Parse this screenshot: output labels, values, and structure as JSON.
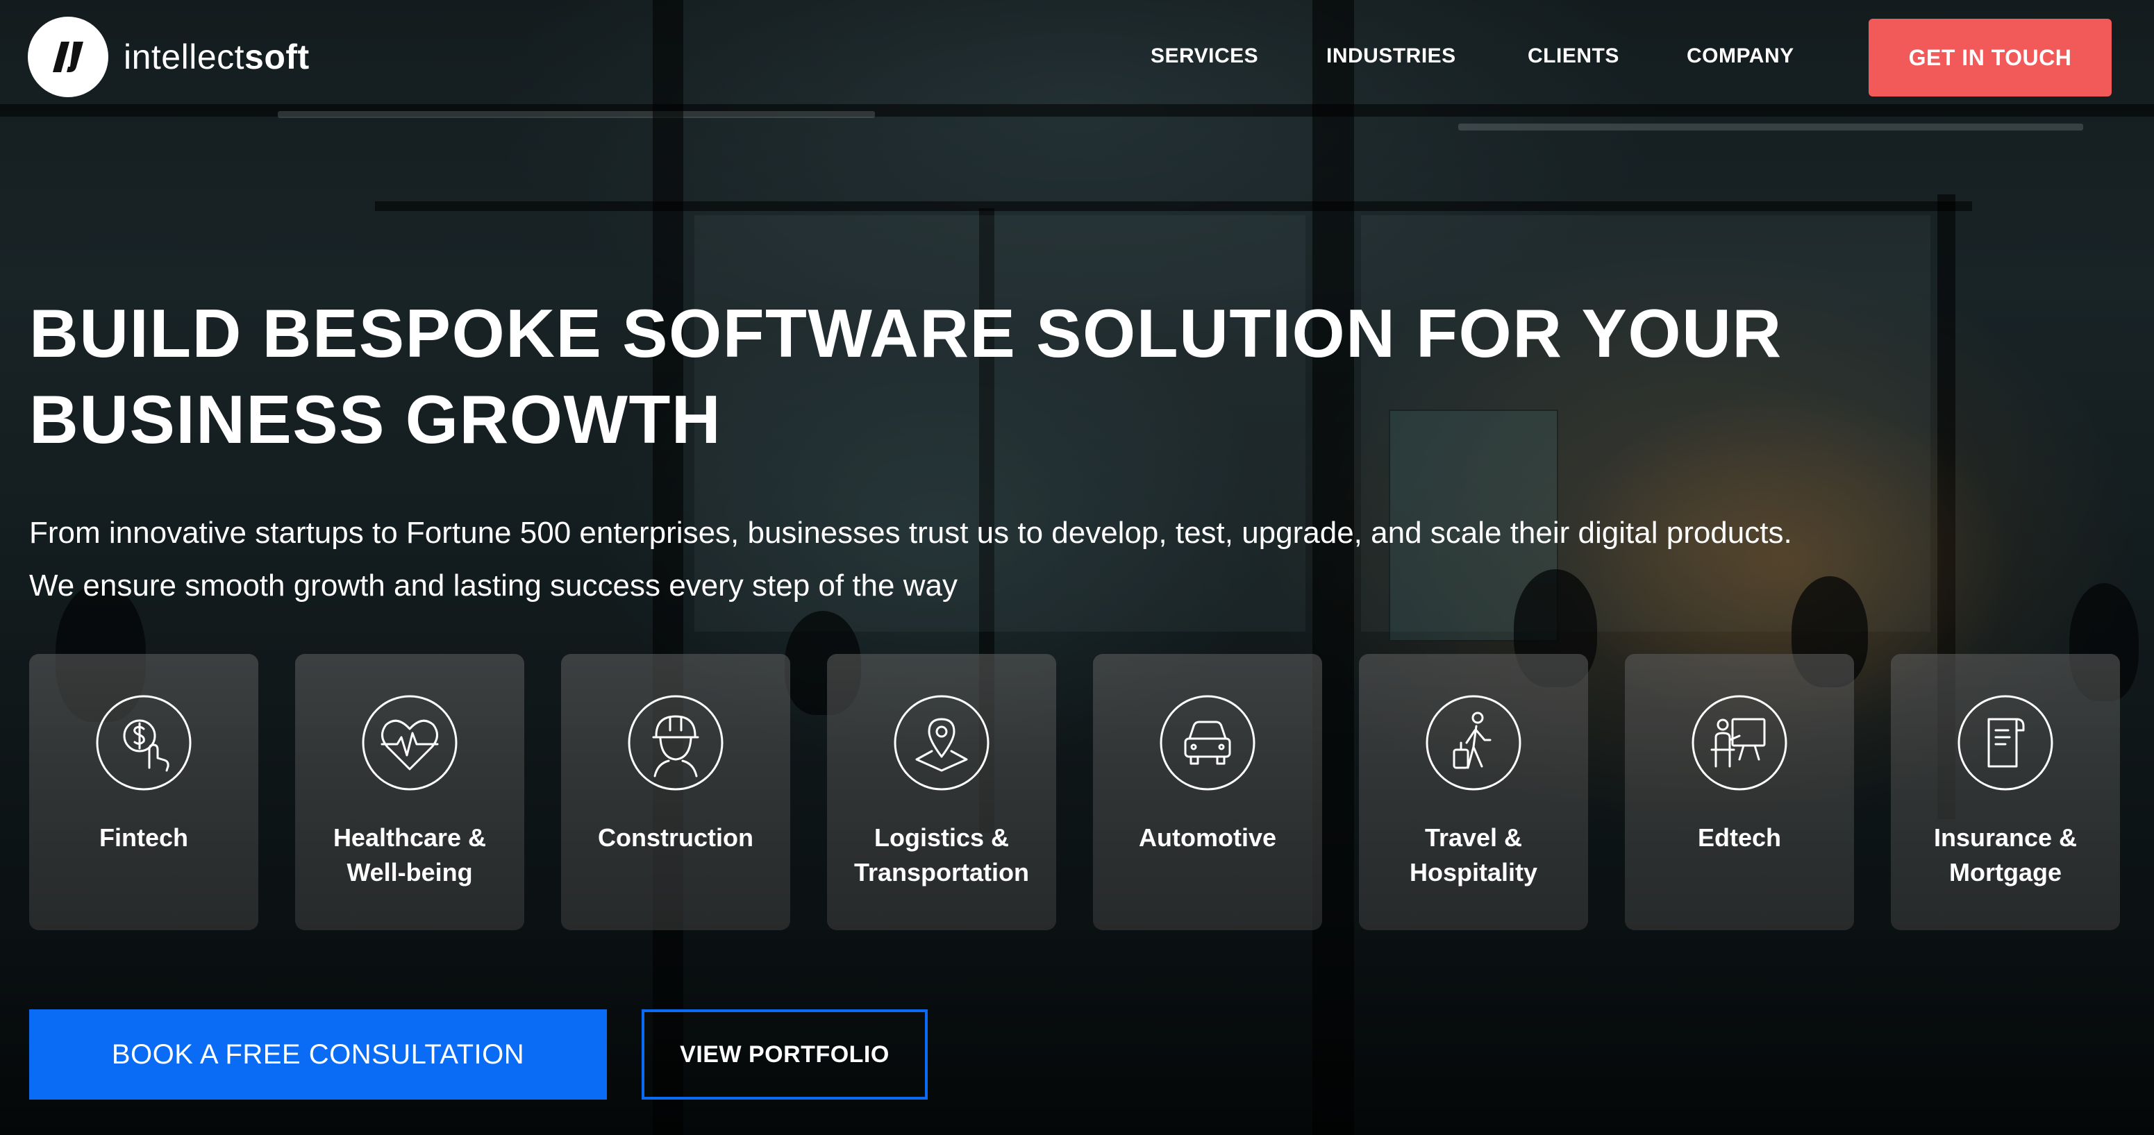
{
  "brand": {
    "logo_mark": "IS",
    "name_light": "intellect",
    "name_bold": "soft"
  },
  "nav": {
    "services": "SERVICES",
    "industries": "INDUSTRIES",
    "clients": "CLIENTS",
    "company": "COMPANY",
    "cta": "GET IN TOUCH"
  },
  "hero": {
    "title_lines": [
      "BUILD BESPOKE SOFTWARE SOLUTION FOR YOUR",
      "BUSINESS GROWTH"
    ],
    "subtitle_lines": [
      "From innovative startups to Fortune 500 enterprises, businesses trust us to develop, test, upgrade, and scale their digital products.",
      "We ensure smooth growth and lasting success every step of the way"
    ]
  },
  "industries": [
    {
      "icon": "dollar-hand-icon",
      "label_lines": [
        "Fintech"
      ]
    },
    {
      "icon": "heart-pulse-icon",
      "label_lines": [
        "Healthcare &",
        "Well-being"
      ]
    },
    {
      "icon": "hard-hat-worker-icon",
      "label_lines": [
        "Construction"
      ]
    },
    {
      "icon": "map-pin-icon",
      "label_lines": [
        "Logistics &",
        "Transportation"
      ]
    },
    {
      "icon": "car-icon",
      "label_lines": [
        "Automotive"
      ]
    },
    {
      "icon": "traveler-suitcase-icon",
      "label_lines": [
        "Travel &",
        "Hospitality"
      ]
    },
    {
      "icon": "teacher-board-icon",
      "label_lines": [
        "Edtech"
      ]
    },
    {
      "icon": "document-icon",
      "label_lines": [
        "Insurance &",
        "Mortgage"
      ]
    }
  ],
  "actions": {
    "consult": "BOOK A FREE CONSULTATION",
    "portfolio": "VIEW PORTFOLIO"
  },
  "colors": {
    "accent_red": "#f25a59",
    "accent_blue": "#0a6cf5",
    "text": "#ffffff"
  }
}
